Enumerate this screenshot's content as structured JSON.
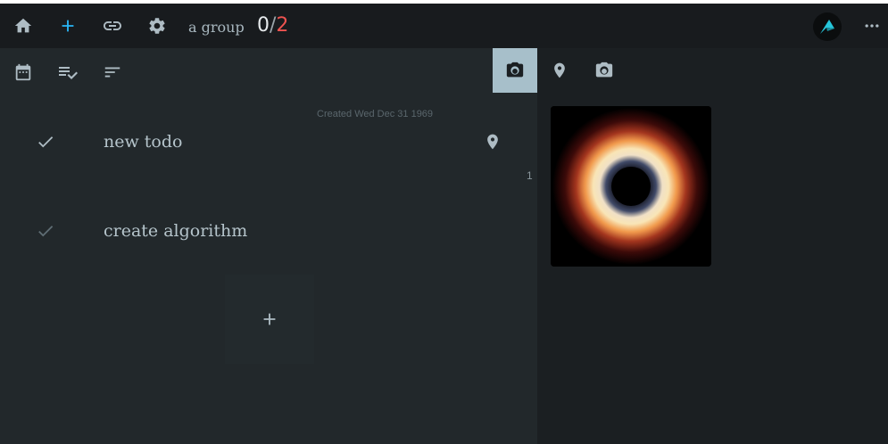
{
  "topbar": {
    "group_name": "a group",
    "done_count": "0",
    "separator": "/",
    "total_count": "2",
    "icons": [
      "home-icon",
      "add-icon",
      "link-icon",
      "gear-icon",
      "avatar",
      "more-icon"
    ],
    "accent": "#29b6f6",
    "total_color": "#ef5350"
  },
  "left_toolbar": {
    "icons": [
      "calendar-icon",
      "checklist-icon",
      "sort-icon"
    ]
  },
  "panel_tabs": {
    "icons": [
      "camera-icon",
      "location-icon",
      "camera-icon"
    ],
    "active_color": "#a7bfca"
  },
  "todos": [
    {
      "label": "new todo",
      "created": "Created Wed Dec 31 1969",
      "count": "1"
    },
    {
      "label": "create algorithm"
    }
  ],
  "add_button": {
    "symbol": "+"
  }
}
